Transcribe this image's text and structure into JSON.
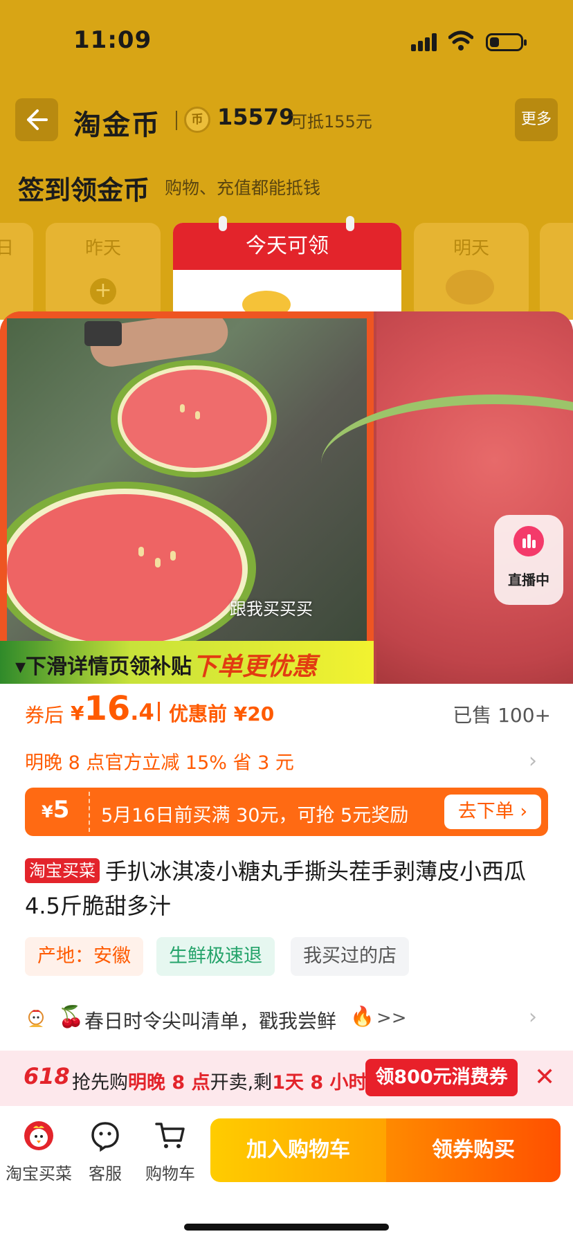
{
  "status_bar": {
    "time": "11:09"
  },
  "header": {
    "brand": "淘金币",
    "coin_icon_glyph": "币",
    "coin_count": "15579",
    "coin_deduct": "可抵155元",
    "more_label": "更多"
  },
  "checkin": {
    "title": "签到领金币",
    "subtitle": "购物、充值都能抵钱",
    "days": [
      {
        "label": "日"
      },
      {
        "label": "昨天"
      },
      {
        "label": "今天可领"
      },
      {
        "label": "明天"
      }
    ]
  },
  "gallery": {
    "caption": "跟我买买买",
    "promo_left": "▾下滑详情页领补贴",
    "promo_right": "下单更优惠",
    "live_label": "直播中"
  },
  "price": {
    "after_label": "券后",
    "currency": "¥",
    "after_int": "16",
    "after_dec": ".4",
    "before_label": "优惠前 ¥20",
    "sold": "已售 100+",
    "tonight": "明晚 8 点官方立减 15% 省 3 元"
  },
  "coupon": {
    "symbol": "¥",
    "amount": "5",
    "text": "5月16日前买满 30元，可抢 5元奖励",
    "button": "去下单 ›"
  },
  "product": {
    "tag": "淘宝买菜",
    "title": "手扒冰淇凌小糖丸手撕头茬手剥薄皮小西瓜4.5斤脆甜多汁"
  },
  "tags": {
    "origin": "产地：安徽",
    "fresh": "生鲜极速退",
    "store": "我买过的店"
  },
  "spring": {
    "cherry": "🍒",
    "text": "春日时令尖叫清单，戳我尝鲜",
    "flame": "🔥",
    "arrow": ">>"
  },
  "promo618": {
    "badge": "618",
    "text_a": "抢先购",
    "text_b": "明晚 8 点",
    "text_c": "开卖,剩",
    "text_d": "1天 8 小时",
    "button": "领800元消费券",
    "close": "✕"
  },
  "bottom_bar": {
    "items": [
      {
        "label": "淘宝买菜",
        "icon": "chicken-logo-icon"
      },
      {
        "label": "客服",
        "icon": "service-icon"
      },
      {
        "label": "购物车",
        "icon": "cart-icon"
      }
    ],
    "add_cart": "加入购物车",
    "buy": "领券购买"
  },
  "colors": {
    "header_bg": "#d8a515",
    "accent_orange": "#ff5a00",
    "accent_red": "#e3242b"
  }
}
